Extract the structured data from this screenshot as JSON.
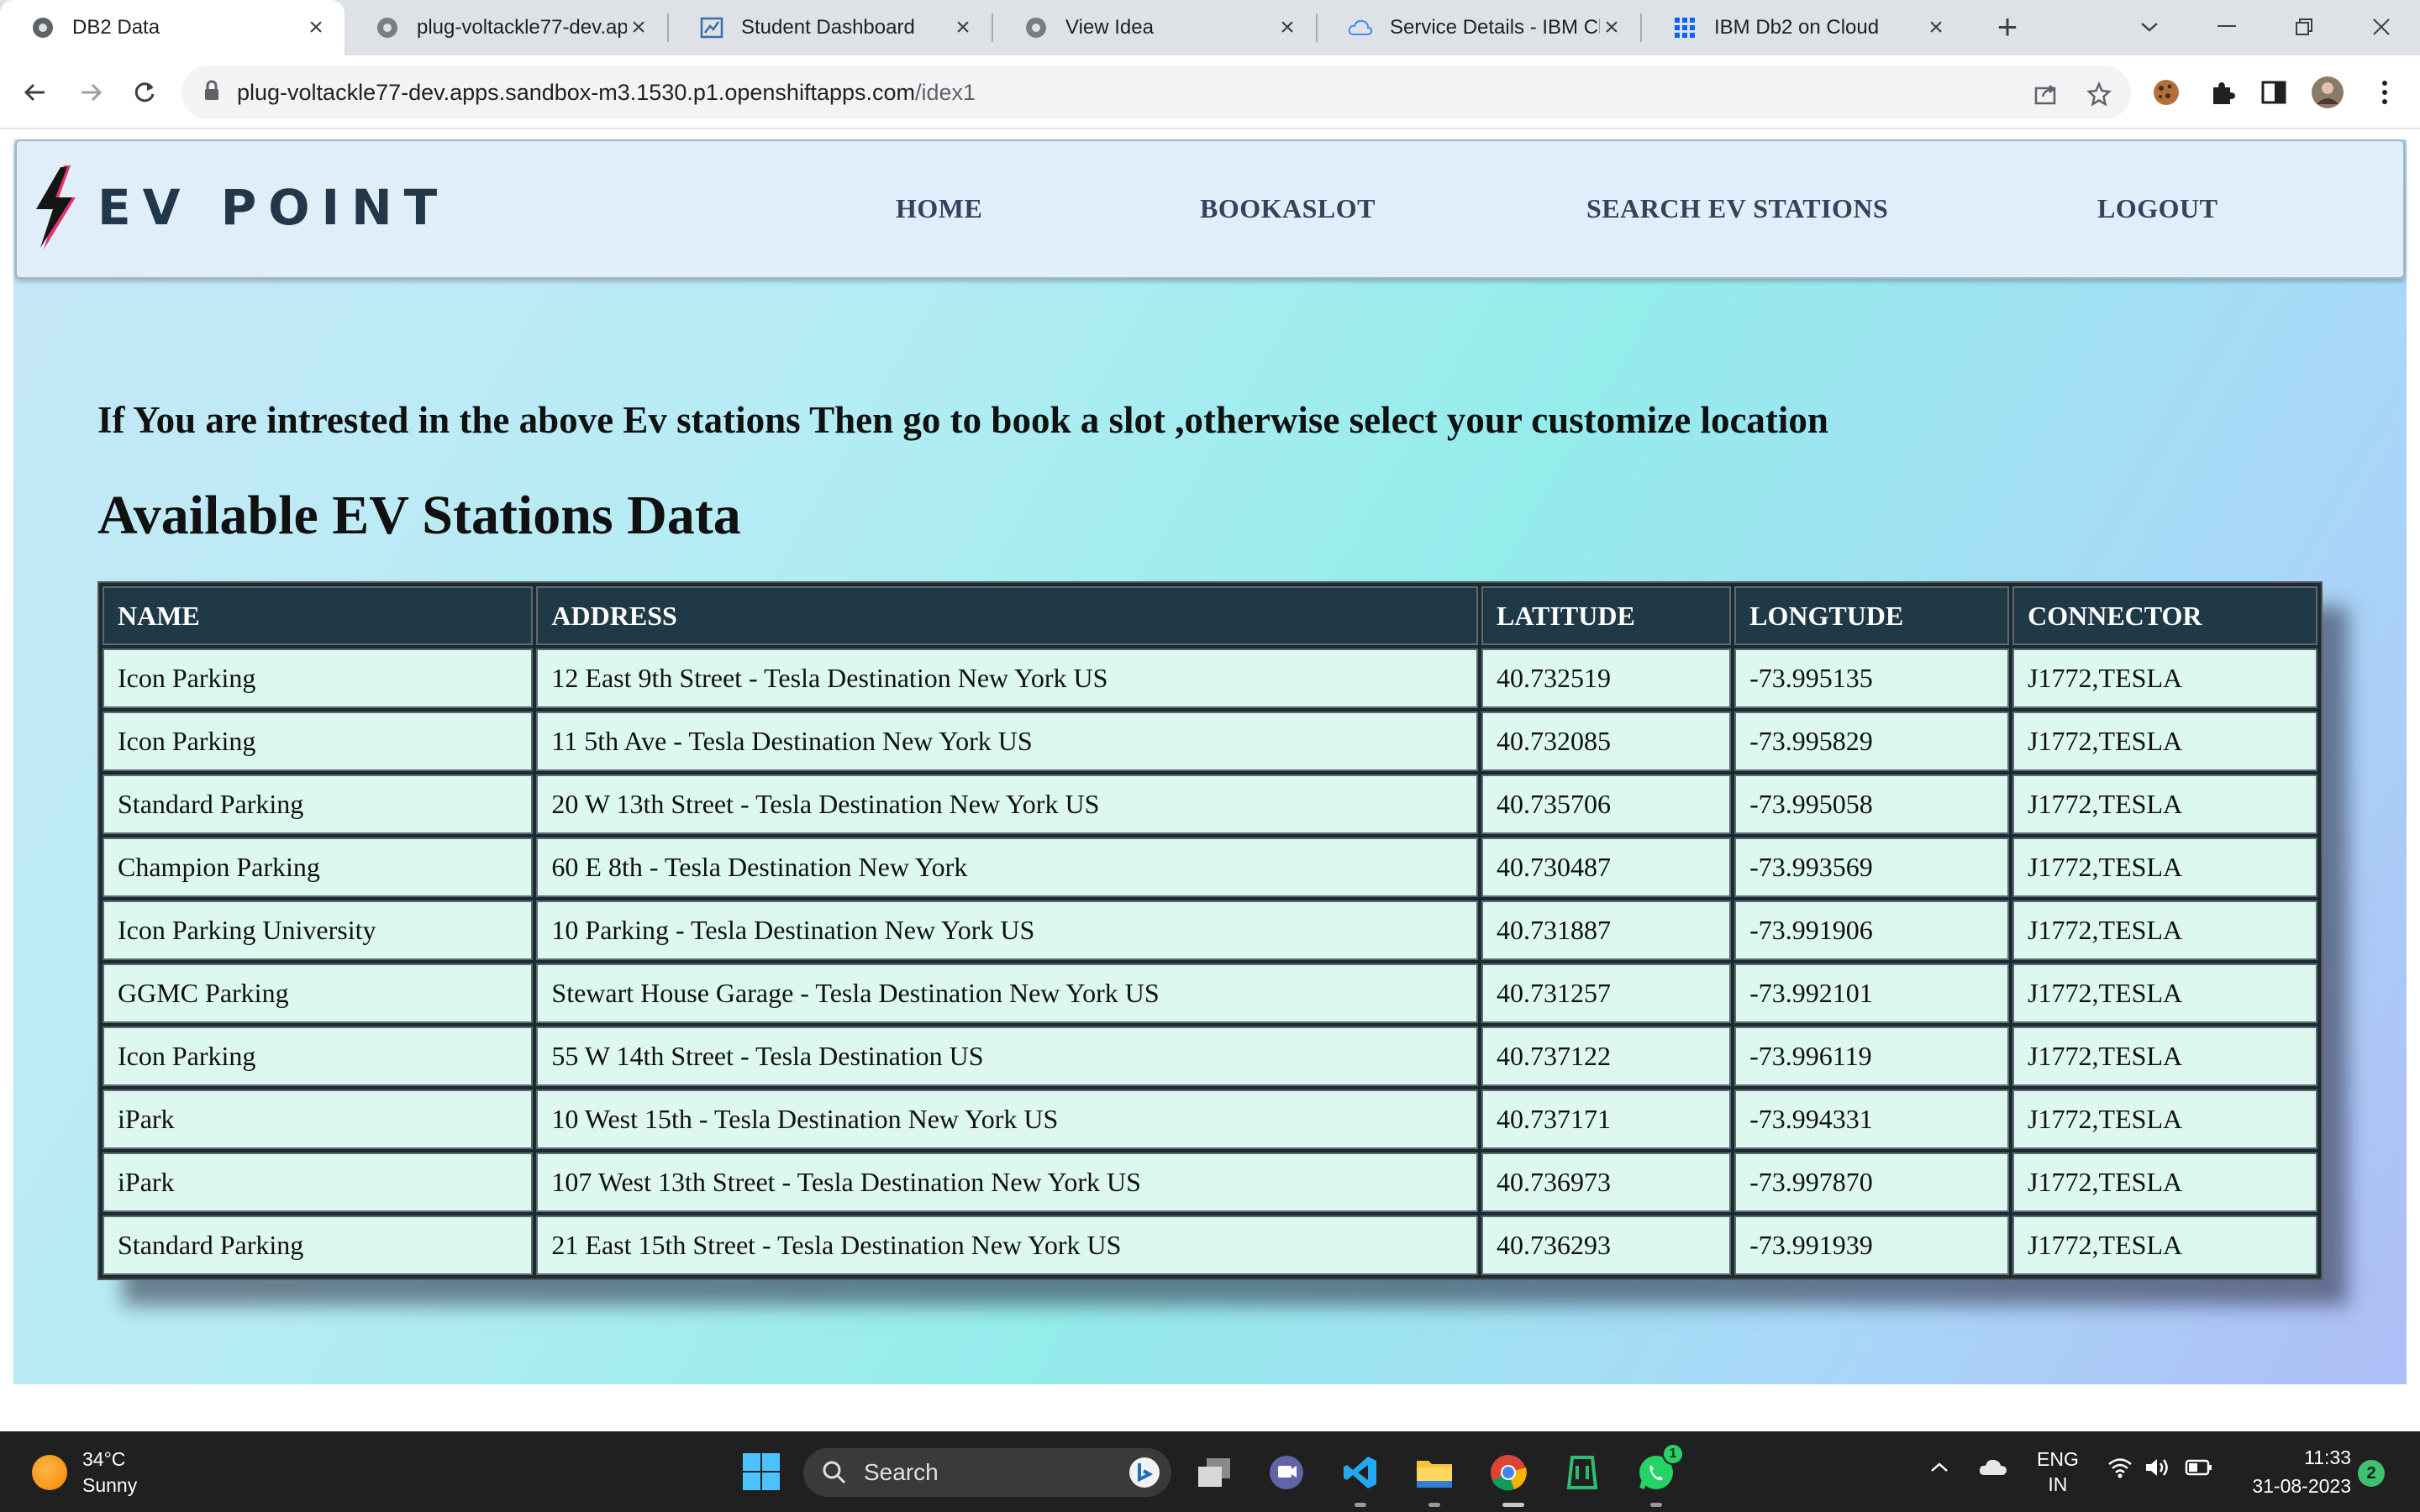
{
  "browser": {
    "tabs": [
      {
        "title": "DB2 Data",
        "active": true
      },
      {
        "title": "plug-voltackle77-dev.ap",
        "active": false
      },
      {
        "title": "Student Dashboard",
        "active": false
      },
      {
        "title": "View Idea",
        "active": false
      },
      {
        "title": "Service Details - IBM Clo",
        "active": false
      },
      {
        "title": "IBM Db2 on Cloud",
        "active": false
      }
    ],
    "url_host": "plug-voltackle77-dev.apps.sandbox-m3.1530.p1.openshiftapps.com",
    "url_path": "/idex1"
  },
  "site": {
    "brand": "EV POINT",
    "nav": [
      "HOME",
      "BOOKASLOT",
      "SEARCH EV STATIONS",
      "LOGOUT"
    ],
    "intro": "If You are intrested in the above Ev stations Then go to book a slot ,otherwise select your customize location",
    "heading": "Available EV Stations Data",
    "table": {
      "headers": [
        "NAME",
        "ADDRESS",
        "LATITUDE",
        "LONGTUDE",
        "CONNECTOR"
      ],
      "rows": [
        [
          "Icon Parking",
          "12 East 9th Street - Tesla Destination New York US",
          "40.732519",
          "-73.995135",
          "J1772,TESLA"
        ],
        [
          "Icon Parking",
          "11 5th Ave - Tesla Destination New York US",
          "40.732085",
          "-73.995829",
          "J1772,TESLA"
        ],
        [
          "Standard Parking",
          "20 W 13th Street - Tesla Destination New York US",
          "40.735706",
          "-73.995058",
          "J1772,TESLA"
        ],
        [
          "Champion Parking",
          "60 E 8th - Tesla Destination New York",
          "40.730487",
          "-73.993569",
          "J1772,TESLA"
        ],
        [
          "Icon Parking University",
          "10 Parking - Tesla Destination New York US",
          "40.731887",
          "-73.991906",
          "J1772,TESLA"
        ],
        [
          "GGMC Parking",
          "Stewart House Garage - Tesla Destination New York US",
          "40.731257",
          "-73.992101",
          "J1772,TESLA"
        ],
        [
          "Icon Parking",
          "55 W 14th Street - Tesla Destination US",
          "40.737122",
          "-73.996119",
          "J1772,TESLA"
        ],
        [
          "iPark",
          "10 West 15th - Tesla Destination New York US",
          "40.737171",
          "-73.994331",
          "J1772,TESLA"
        ],
        [
          "iPark",
          "107 West 13th Street - Tesla Destination New York US",
          "40.736973",
          "-73.997870",
          "J1772,TESLA"
        ],
        [
          "Standard Parking",
          "21 East 15th Street - Tesla Destination New York US",
          "40.736293",
          "-73.991939",
          "J1772,TESLA"
        ]
      ]
    }
  },
  "taskbar": {
    "weather_temp": "34°C",
    "weather_desc": "Sunny",
    "search_placeholder": "Search",
    "lang_top": "ENG",
    "lang_bottom": "IN",
    "time": "11:33",
    "date": "31-08-2023",
    "notification_count": "2",
    "whatsapp_badge": "1"
  },
  "colors": {
    "tab_strip": "#dee1e6",
    "navbar_bg": "#dfeef8",
    "table_header_bg": "#1f3a46",
    "table_cell_bg": "#dcf8ef",
    "taskbar_bg": "#202020"
  }
}
